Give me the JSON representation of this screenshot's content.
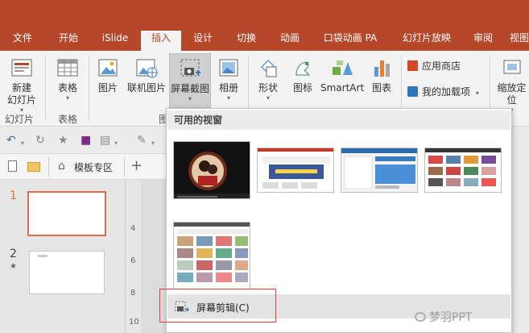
{
  "tabs": [
    "文件",
    "开始",
    "iSlide",
    "插入",
    "设计",
    "切换",
    "动画",
    "口袋动画 PA",
    "幻灯片放映",
    "审阅",
    "视图"
  ],
  "active_tab": "插入",
  "ribbon": {
    "new_slide": "新建",
    "new_slide_2": "幻灯片",
    "table": "表格",
    "picture": "图片",
    "online_picture": "联机图片",
    "screenshot": "屏幕截图",
    "album": "相册",
    "shapes": "形状",
    "icons": "图标",
    "smartart": "SmartArt",
    "chart": "图表",
    "app_store": "应用商店",
    "my_addins": "我的加载项",
    "zoom_1": "缩放定",
    "zoom_2": "位",
    "group_slides": "幻灯片",
    "group_table": "表格",
    "group_images": "图"
  },
  "doc_tab": "模板专区",
  "slides": [
    {
      "num": "1"
    },
    {
      "num": "2",
      "star": "★"
    }
  ],
  "ruler": [
    "4",
    "6",
    "8",
    "10"
  ],
  "dropdown": {
    "header": "可用的视窗",
    "screen_clipping": "屏幕剪辑(C)"
  },
  "watermark": "梦羽PPT",
  "colors": {
    "brand": "#b7472a",
    "highlight": "#e1403a",
    "selected_slide": "#e26b4a"
  }
}
